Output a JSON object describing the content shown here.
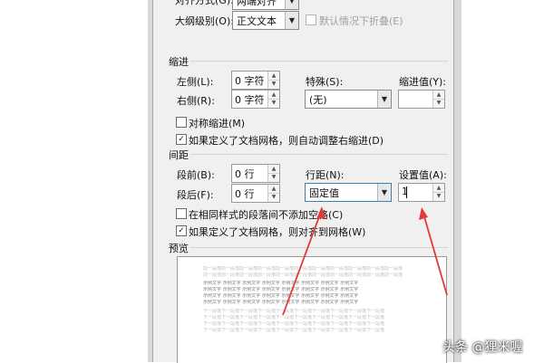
{
  "top": {
    "alignment_label": "对齐方式(G):",
    "alignment_value": "两端对齐",
    "outline_label": "大纲级别(O):",
    "outline_value": "正文文本",
    "collapse_label": "默认情况下折叠(E)"
  },
  "indent": {
    "section": "缩进",
    "left_label": "左侧(L):",
    "left_value": "0 字符",
    "right_label": "右侧(R):",
    "right_value": "0 字符",
    "special_label": "特殊(S):",
    "special_value": "(无)",
    "indent_by_label": "缩进值(Y):",
    "mirror_label": "对称缩进(M)",
    "mirror_checked": false,
    "auto_adjust_label": "如果定义了文档网格，则自动调整右缩进(D)",
    "auto_adjust_checked": true
  },
  "spacing": {
    "section": "间距",
    "before_label": "段前(B):",
    "before_value": "0 行",
    "after_label": "段后(F):",
    "after_value": "0 行",
    "line_label": "行距(N):",
    "line_value": "固定值",
    "at_label": "设置值(A):",
    "at_value": "1",
    "no_space_label": "在相同样式的段落间不添加空格(C)",
    "no_space_checked": false,
    "snap_grid_label": "如果定义了文档网格，则对齐到网格(W)",
    "snap_grid_checked": true
  },
  "preview": {
    "section": "预览",
    "prev_para": "前一段落前一段落前一段落前一段落前一段落前一段落前一段落前一段落前一段落前一段落前一段落",
    "sample": "示例文字 示例文字 示例文字 示例文字 示例文字 示例文字 示例文字 示例文字",
    "next_para": "下一段落下一段落下一段落下一段落下一段落下一段落下一段落下一段落下一段落下一段落"
  },
  "icons": {
    "check": "✓",
    "spin_up": "▲",
    "spin_down": "▼",
    "combo_arrow": "▼"
  },
  "watermark": "头条 @狸米喔",
  "colors": {
    "annotation_arrow": "#e03a3a",
    "focus_border": "#3c7fb1"
  }
}
